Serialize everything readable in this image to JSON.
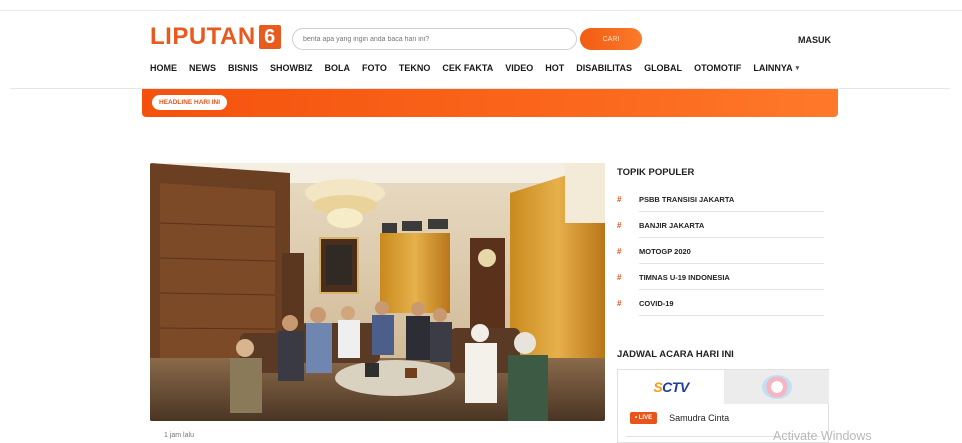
{
  "header": {
    "logo_text": "LIPUTAN",
    "logo_number": "6",
    "search_placeholder": "berita apa yang ingin anda baca hari ini?",
    "search_button": "CARI",
    "login": "MASUK"
  },
  "nav": {
    "items": [
      "HOME",
      "NEWS",
      "BISNIS",
      "SHOWBIZ",
      "BOLA",
      "FOTO",
      "TEKNO",
      "CEK FAKTA",
      "VIDEO",
      "HOT",
      "DISABILITAS",
      "GLOBAL",
      "OTOMOTIF"
    ],
    "more": "LAINNYA"
  },
  "headline": {
    "label": "HEADLINE HARI INI"
  },
  "article": {
    "timestamp": "1 jam lalu"
  },
  "topik_populer": {
    "title": "TOPIK POPULER",
    "hash": "#",
    "items": [
      "PSBB TRANSISI JAKARTA",
      "BANJIR JAKARTA",
      "MOTOGP 2020",
      "TIMNAS U-19 INDONESIA",
      "COVID-19"
    ]
  },
  "jadwal": {
    "title": "JADWAL ACARA HARI INI",
    "channels": [
      "SCTV",
      "INDOSIAR"
    ],
    "live_badge": "• LIVE",
    "program": "Samudra Cinta"
  },
  "os": {
    "watermark": "Activate Windows"
  },
  "colors": {
    "accent": "#e8541a",
    "text": "#1d1d1d"
  }
}
